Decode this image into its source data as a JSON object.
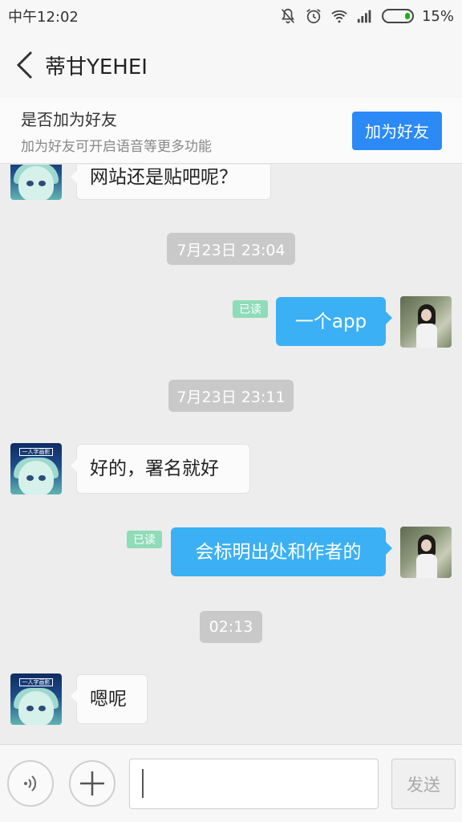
{
  "status_bar": {
    "carrier_time": "中午12:02",
    "battery_percent": "15%",
    "battery_level": 0.15,
    "icons": [
      "mute-bell-icon",
      "alarm-icon",
      "wifi-icon",
      "signal-icon",
      "battery-icon"
    ]
  },
  "header": {
    "title": "蒂甘YEHEI",
    "back_icon": "back-chevron-icon"
  },
  "banner": {
    "title": "是否加为好友",
    "subtitle": "加为好友可开启语音等更多功能",
    "button_label": "加为好友",
    "button_color": "#2b8af5"
  },
  "messages": [
    {
      "kind": "in",
      "text": "网站还是贴吧呢？"
    },
    {
      "kind": "time",
      "text": "7月23日 23:04"
    },
    {
      "kind": "out",
      "text": "一个app",
      "read_label": "已读"
    },
    {
      "kind": "time",
      "text": "7月23日 23:11"
    },
    {
      "kind": "in",
      "text": "好的，署名就好"
    },
    {
      "kind": "out",
      "text": "会标明出处和作者的",
      "read_label": "已读"
    },
    {
      "kind": "time",
      "text": "02:13"
    },
    {
      "kind": "in",
      "text": "嗯呢"
    }
  ],
  "avatar_tag": "一人字画影",
  "colors": {
    "outgoing_bubble": "#3cb0f5",
    "incoming_bubble": "#fbfbfb",
    "read_badge": "#8fdcb8",
    "timestamp_bg": "#c9c9c9"
  },
  "input_bar": {
    "voice_icon": "voice-icon",
    "plus_icon": "plus-icon",
    "input_value": "",
    "send_label": "发送"
  }
}
